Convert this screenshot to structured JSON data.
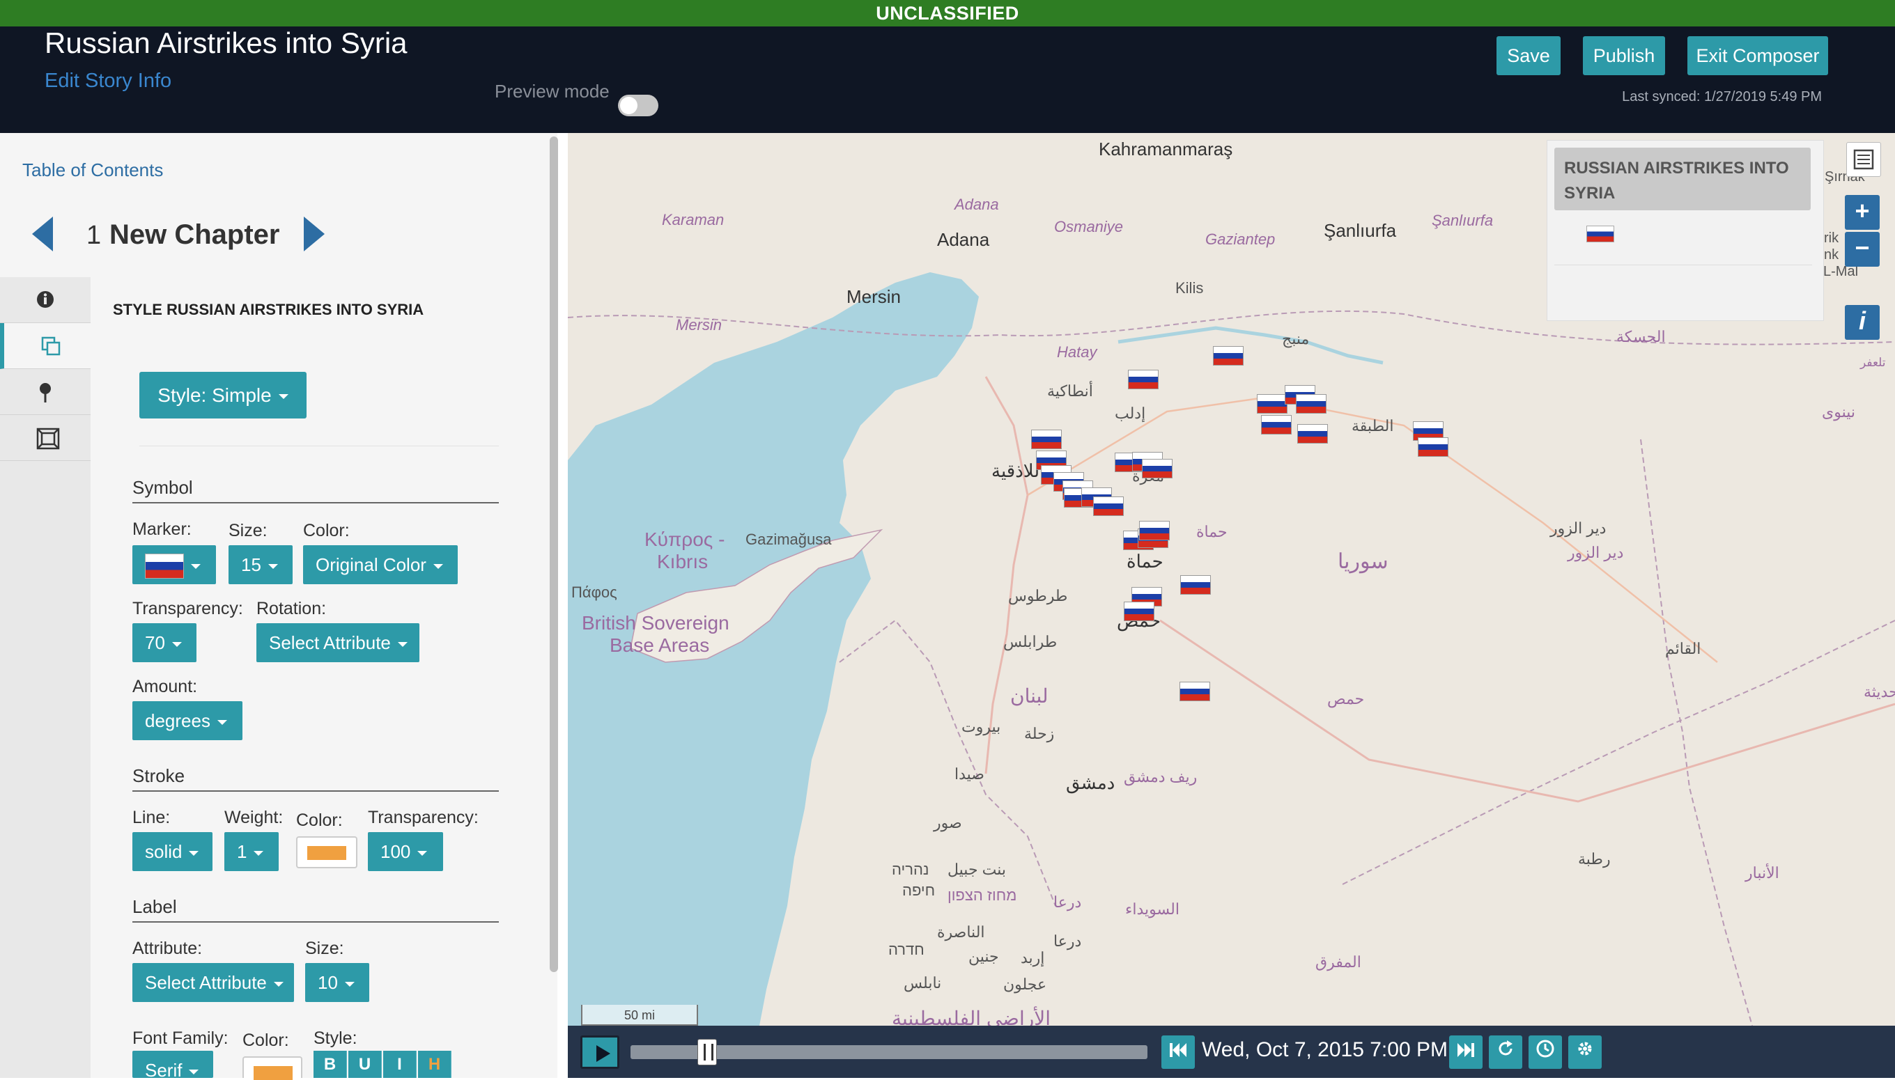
{
  "banner": {
    "text": "UNCLASSIFIED"
  },
  "header": {
    "title": "Russian Airstrikes into Syria",
    "edit_link": "Edit Story Info",
    "preview_label": "Preview mode",
    "buttons": {
      "save": "Save",
      "publish": "Publish",
      "exit": "Exit Composer"
    },
    "last_synced": "Last synced: 1/27/2019 5:49 PM"
  },
  "sidebar": {
    "toc_link": "Table of Contents",
    "chapter_number": "1",
    "chapter_name": "New Chapter",
    "tabs": [
      {
        "icon": "info-icon"
      },
      {
        "icon": "layers-icon"
      },
      {
        "icon": "map-pin-icon"
      },
      {
        "icon": "frame-icon"
      }
    ],
    "style_title": "STYLE RUSSIAN AIRSTRIKES INTO SYRIA",
    "style_button": "Style: Simple",
    "symbol": {
      "heading": "Symbol",
      "marker_label": "Marker:",
      "size_label": "Size:",
      "size_value": "15",
      "color_label": "Color:",
      "color_value": "Original Color",
      "transparency_label": "Transparency:",
      "transparency_value": "70",
      "rotation_label": "Rotation:",
      "rotation_value": "Select Attribute",
      "amount_label": "Amount:",
      "amount_value": "degrees"
    },
    "stroke": {
      "heading": "Stroke",
      "line_label": "Line:",
      "line_value": "solid",
      "weight_label": "Weight:",
      "weight_value": "1",
      "color_label": "Color:",
      "color_swatch": "#f0a040",
      "transparency_label": "Transparency:",
      "transparency_value": "100"
    },
    "label": {
      "heading": "Label",
      "attribute_label": "Attribute:",
      "attribute_value": "Select Attribute",
      "size_label": "Size:",
      "size_value": "10",
      "font_family_label": "Font Family:",
      "font_family_value": "Serif",
      "color_label": "Color:",
      "color_swatch": "#f0a040",
      "style_label": "Style:",
      "style_buttons": [
        "B",
        "U",
        "I",
        "H"
      ]
    }
  },
  "map": {
    "labels": {
      "kahramanmaras": "Kahramanmaraş",
      "karaman": "Karaman",
      "adana_it": "Adana",
      "adana": "Adana",
      "osmaniye": "Osmaniye",
      "gaziantep": "Gaziantep",
      "sanliurfa": "Şanlıurfa",
      "sanliurfa2": "Şanlıurfa",
      "mersin": "Mersin",
      "mersin2": "Mersin",
      "kilis": "Kilis",
      "hatay": "Hatay",
      "manbij": "منبج",
      "hasakah": "الحسكة",
      "antakya": "أنطاكية",
      "idlib": "إدلب",
      "raqqa": "الطبقة",
      "latakia": "اللاذقية",
      "maarat": "معرة",
      "kypros": "Κύπρος -",
      "kibris": "Kıbrıs",
      "gazimagusa": "Gazimağusa",
      "pafos": "Πάφος",
      "british1": "British Sovereign",
      "british2": "Base Areas",
      "hama1": "حماة",
      "hama2": "حماة",
      "syria": "سوريا",
      "deir1": "دير الزور",
      "deir2": "دير الزور",
      "tartus": "طرطوس",
      "homs": "حمص",
      "tripoli": "طرابلس",
      "lebanon": "لبنان",
      "homs2": "حمص",
      "qaim": "القائم",
      "beirut": "بيروت",
      "zahle": "زحلة",
      "saida": "صيدا",
      "damascus": "دمشق",
      "rifdimashq": "ريف دمشق",
      "sur": "صور",
      "nahariya": "נהריה",
      "haifa": "חיפה",
      "bintjbeil": "بنت جبيل",
      "hatzafon": "מחוז הצפון",
      "daraa": "درعا",
      "suwayda": "السويداء",
      "nazareth": "الناصرة",
      "hadera": "חדרה",
      "jenin": "جنين",
      "irbid": "إربد",
      "daraa2": "درعا",
      "rutba": "رطبة",
      "anbar": "الأنبار",
      "mafraq": "المفرق",
      "nablus": "نابلس",
      "ajloun": "عجلون",
      "ninawa": "نينوى",
      "qadisiya": "حديثة",
      "tallafar": "تلعفر",
      "palestine": "الأراضي الفلسطينية"
    },
    "legend_title": "RUSSIAN AIRSTRIKES INTO SYRIA",
    "right_edge_labels": [
      "Şırnak",
      "rik",
      "nk",
      "L-Mal"
    ],
    "zoom_in": "+",
    "zoom_out": "−",
    "info_btn": "i",
    "scale": "50 mi",
    "flag_colors": [
      "#ffffff",
      "#1c3fa8",
      "#d52b1e"
    ]
  },
  "timeline": {
    "datetime": "Wed, Oct 7, 2015 7:00 PM",
    "progress": 0.05
  }
}
